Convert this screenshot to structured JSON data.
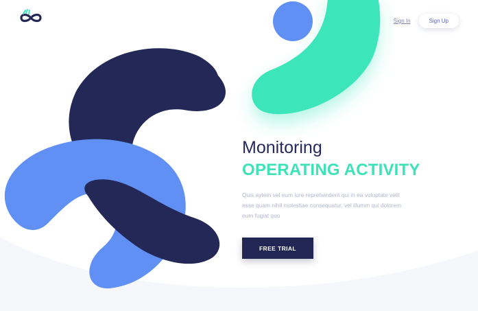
{
  "header": {
    "sign_in": "Sign In",
    "sign_up": "Sign Up"
  },
  "hero": {
    "title": "Monitoring",
    "subtitle": "OPERATING ACTIVITY",
    "description": "Quis aytem vel eum iure reprehenderit qui in ea voluptate velit esse quam nihil molestiae consequatur, vel illumm qui dolorem eum fugiat quo",
    "cta": "FREE TRIAL"
  },
  "colors": {
    "navy": "#242856",
    "blue": "#6090f4",
    "mint": "#3ce6ba",
    "background": "#ffffff"
  },
  "icons": [
    "logo-infinity-icon"
  ]
}
